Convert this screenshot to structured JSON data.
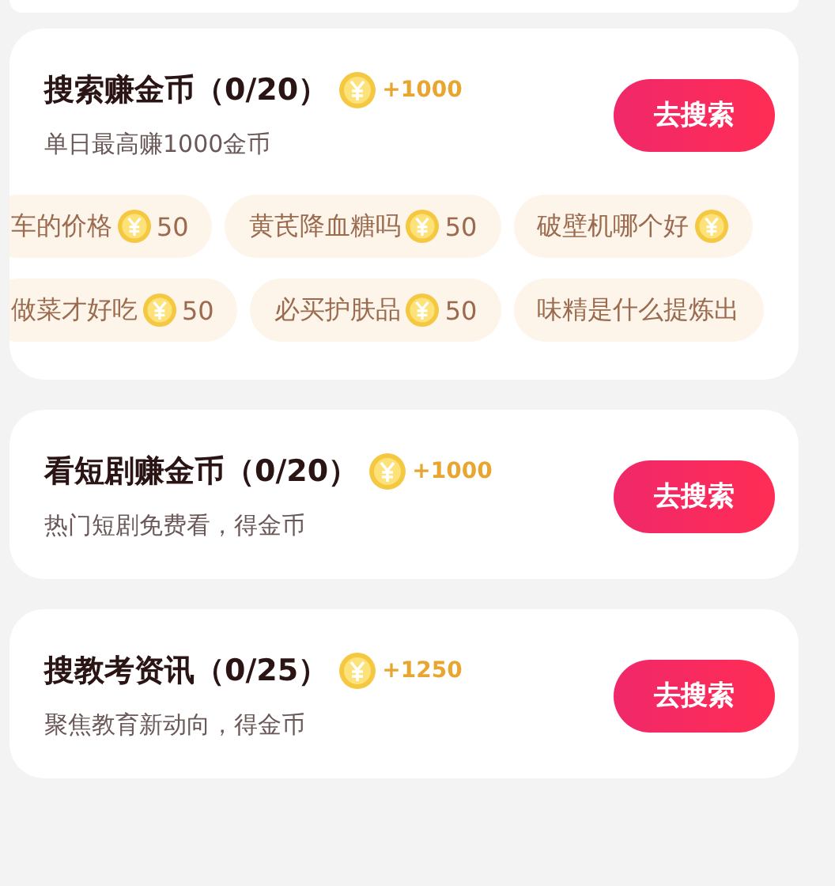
{
  "tasks": [
    {
      "title": "搜索赚金币（0/20）",
      "reward": "+1000",
      "subtitle": "单日最高赚1000金币",
      "button": "去搜索",
      "chip_rows": [
        [
          {
            "text": "车的价格",
            "coin": true,
            "points": "50"
          },
          {
            "text": "黄芪降血糖吗",
            "coin": true,
            "points": "50"
          },
          {
            "text": "破壁机哪个好",
            "coin": true
          }
        ],
        [
          {
            "text": "做菜才好吃",
            "coin": true,
            "points": "50"
          },
          {
            "text": "必买护肤品",
            "coin": true,
            "points": "50"
          },
          {
            "text": "味精是什么提炼出",
            "coin": false
          }
        ]
      ]
    },
    {
      "title": "看短剧赚金币（0/20）",
      "reward": "+1000",
      "subtitle": "热门短剧免费看，得金币",
      "button": "去搜索"
    },
    {
      "title": "搜教考资讯（0/25）",
      "reward": "+1250",
      "subtitle": "聚焦教育新动向，得金币",
      "button": "去搜索"
    }
  ]
}
